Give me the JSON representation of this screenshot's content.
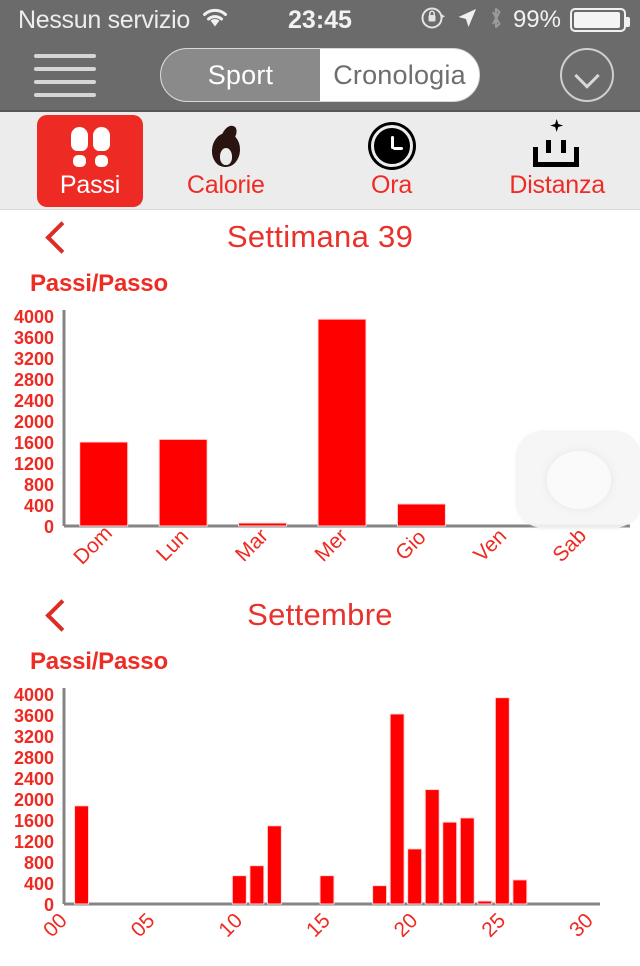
{
  "statusbar": {
    "carrier": "Nessun servizio",
    "wifi_icon": "wifi-icon",
    "time": "23:45",
    "rotation_lock_icon": "rotation-lock-icon",
    "location_icon": "location-arrow-icon",
    "bluetooth_icon": "bluetooth-icon",
    "battery_percent": "99%",
    "battery_icon": "battery-full-icon"
  },
  "navbar": {
    "menu_icon": "hamburger-menu-icon",
    "segments": [
      {
        "label": "Sport",
        "selected": true
      },
      {
        "label": "Cronologia",
        "selected": false
      }
    ],
    "dropdown_icon": "chevron-down-circle-icon"
  },
  "tabbar": {
    "tabs": [
      {
        "label": "Passi",
        "icon": "footprints-icon",
        "selected": true
      },
      {
        "label": "Calorie",
        "icon": "flame-icon",
        "selected": false
      },
      {
        "label": "Ora",
        "icon": "clock-icon",
        "selected": false
      },
      {
        "label": "Distanza",
        "icon": "ruler-icon",
        "selected": false
      }
    ]
  },
  "colors": {
    "accent_red": "#ed2d25",
    "bar_red": "#FF0000",
    "tab_selected_bg": "#ee2a24",
    "navbar_gray": "#6b6b6b",
    "tabbar_gray": "#ececec",
    "axis_gray": "#808080"
  },
  "week_section": {
    "back_icon": "chevron-left-icon",
    "title": "Settimana 39",
    "y_axis_label": "Passi/Passo"
  },
  "month_section": {
    "back_icon": "chevron-left-icon",
    "title": "Settembre",
    "y_axis_label": "Passi/Passo"
  },
  "assistive_touch": {
    "icon": "assistive-touch-button"
  },
  "chart_data": [
    {
      "type": "bar",
      "title": "Settimana 39",
      "ylabel": "Passi/Passo",
      "xlabel": "",
      "categories": [
        "Dom",
        "Lun",
        "Mar",
        "Mer",
        "Gio",
        "Ven",
        "Sab"
      ],
      "values": [
        1600,
        1650,
        30,
        3940,
        420,
        0,
        0
      ],
      "yticks": [
        0,
        400,
        800,
        1200,
        1600,
        2000,
        2400,
        2800,
        3200,
        3600,
        4000
      ],
      "ylim": [
        0,
        4000
      ],
      "grid": false,
      "legend": "none",
      "bar_color": "#FF0000"
    },
    {
      "type": "bar",
      "title": "Settembre",
      "ylabel": "Passi/Passo",
      "xlabel": "",
      "x": [
        0,
        1,
        2,
        3,
        4,
        5,
        6,
        7,
        8,
        9,
        10,
        11,
        12,
        13,
        14,
        15,
        16,
        17,
        18,
        19,
        20,
        21,
        22,
        23,
        24,
        25,
        26,
        27,
        28,
        29,
        30
      ],
      "xticks": [
        "00",
        "05",
        "10",
        "15",
        "20",
        "25",
        "30"
      ],
      "xtick_values": [
        0,
        5,
        10,
        15,
        20,
        25,
        30
      ],
      "values": [
        0,
        1870,
        0,
        0,
        0,
        0,
        0,
        0,
        0,
        0,
        540,
        730,
        1490,
        0,
        0,
        540,
        0,
        0,
        350,
        3620,
        1050,
        2180,
        1560,
        1640,
        40,
        3930,
        460,
        0,
        0,
        0,
        0
      ],
      "yticks": [
        0,
        400,
        800,
        1200,
        1600,
        2000,
        2400,
        2800,
        3200,
        3600,
        4000
      ],
      "ylim": [
        0,
        4000
      ],
      "grid": false,
      "legend": "none",
      "bar_color": "#FF0000"
    }
  ]
}
